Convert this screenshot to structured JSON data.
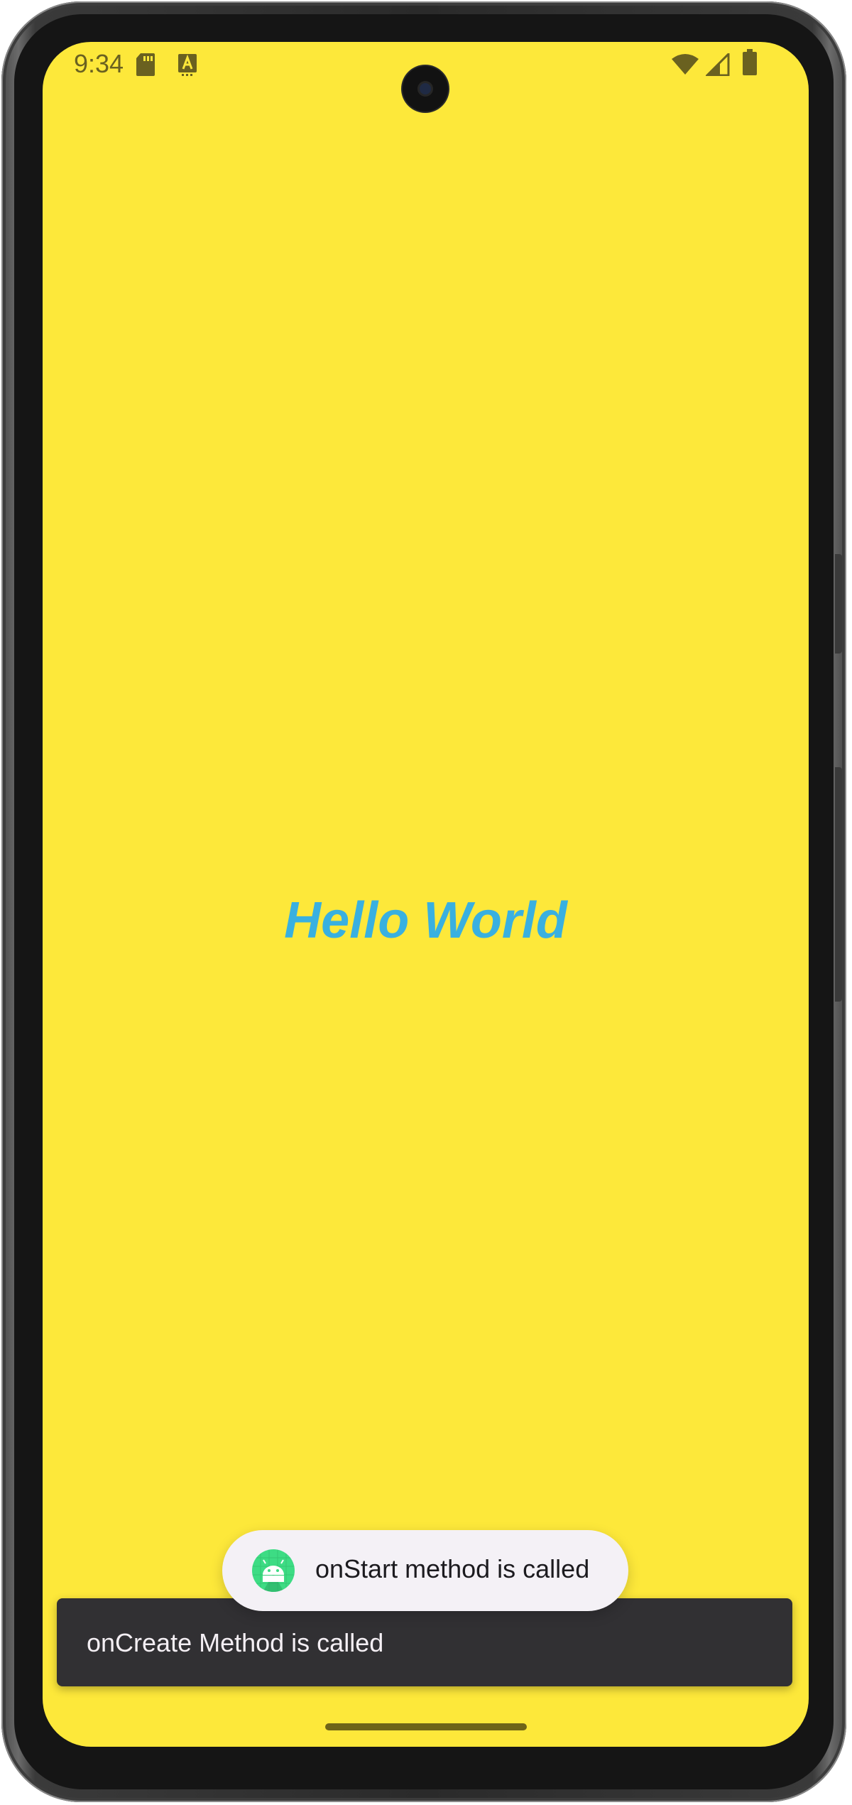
{
  "status_bar": {
    "time": "9:34",
    "left_icons": [
      "sd-card-icon",
      "text-a-icon"
    ],
    "right_icons": [
      "wifi-icon",
      "signal-icon",
      "battery-icon"
    ]
  },
  "main": {
    "hello_text": "Hello World"
  },
  "toast": {
    "icon": "android-icon",
    "text": "onStart method is called"
  },
  "snackbar": {
    "text": "onCreate Method is called"
  },
  "colors": {
    "background": "#fde83a",
    "hello_text": "#39b0e0",
    "snackbar": "#313033",
    "toast": "#f4f1f6",
    "android_green": "#3ddc84"
  }
}
